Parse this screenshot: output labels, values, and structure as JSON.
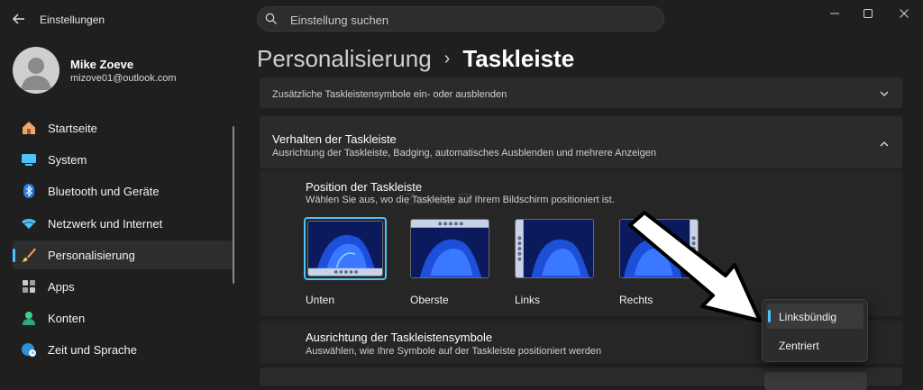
{
  "window": {
    "title": "Einstellungen",
    "icons": {
      "back": "arrow-left-icon",
      "minimize": "minimize-icon",
      "maximize": "maximize-icon",
      "close": "close-icon"
    }
  },
  "search": {
    "placeholder": "Einstellung suchen",
    "icon": "search-icon"
  },
  "user": {
    "name": "Mike Zoeve",
    "email": "mizove01@outlook.com"
  },
  "sidebar": {
    "items": [
      {
        "label": "Startseite",
        "icon": "home-icon"
      },
      {
        "label": "System",
        "icon": "monitor-icon"
      },
      {
        "label": "Bluetooth und Geräte",
        "icon": "bluetooth-icon"
      },
      {
        "label": "Netzwerk und Internet",
        "icon": "wifi-icon"
      },
      {
        "label": "Personalisierung",
        "icon": "brush-icon",
        "selected": true
      },
      {
        "label": "Apps",
        "icon": "apps-icon"
      },
      {
        "label": "Konten",
        "icon": "person-icon"
      },
      {
        "label": "Zeit und Sprache",
        "icon": "globe-clock-icon"
      }
    ]
  },
  "breadcrumb": {
    "parent": "Personalisierung",
    "separator": "›",
    "current": "Taskleiste"
  },
  "sections": {
    "tray_icons": {
      "subtitle": "Zusätzliche Taskleistensymbole ein- oder ausblenden"
    },
    "behavior": {
      "title": "Verhalten der Taskleiste",
      "subtitle": "Ausrichtung der Taskleiste, Badging, automatisches Ausblenden und mehrere Anzeigen"
    },
    "position": {
      "title": "Position der Taskleiste",
      "subtitle": "Wählen Sie aus, wo die Taskleiste auf Ihrem Bildschirm positioniert ist.",
      "options": [
        {
          "label": "Unten",
          "selected": true
        },
        {
          "label": "Oberste"
        },
        {
          "label": "Links"
        },
        {
          "label": "Rechts"
        }
      ]
    },
    "alignment": {
      "title": "Ausrichtung der Taskleistensymbole",
      "subtitle": "Auswählen, wie Ihre Symbole auf der Taskleiste positioniert werden",
      "dropdown": {
        "options": [
          "Linksbündig",
          "Zentriert"
        ],
        "selected": "Linksbündig"
      }
    }
  },
  "watermark": "Zoeve IT",
  "colors": {
    "accent": "#4cc2ff",
    "background": "#1f1f1f",
    "card": "#2b2b2b"
  }
}
